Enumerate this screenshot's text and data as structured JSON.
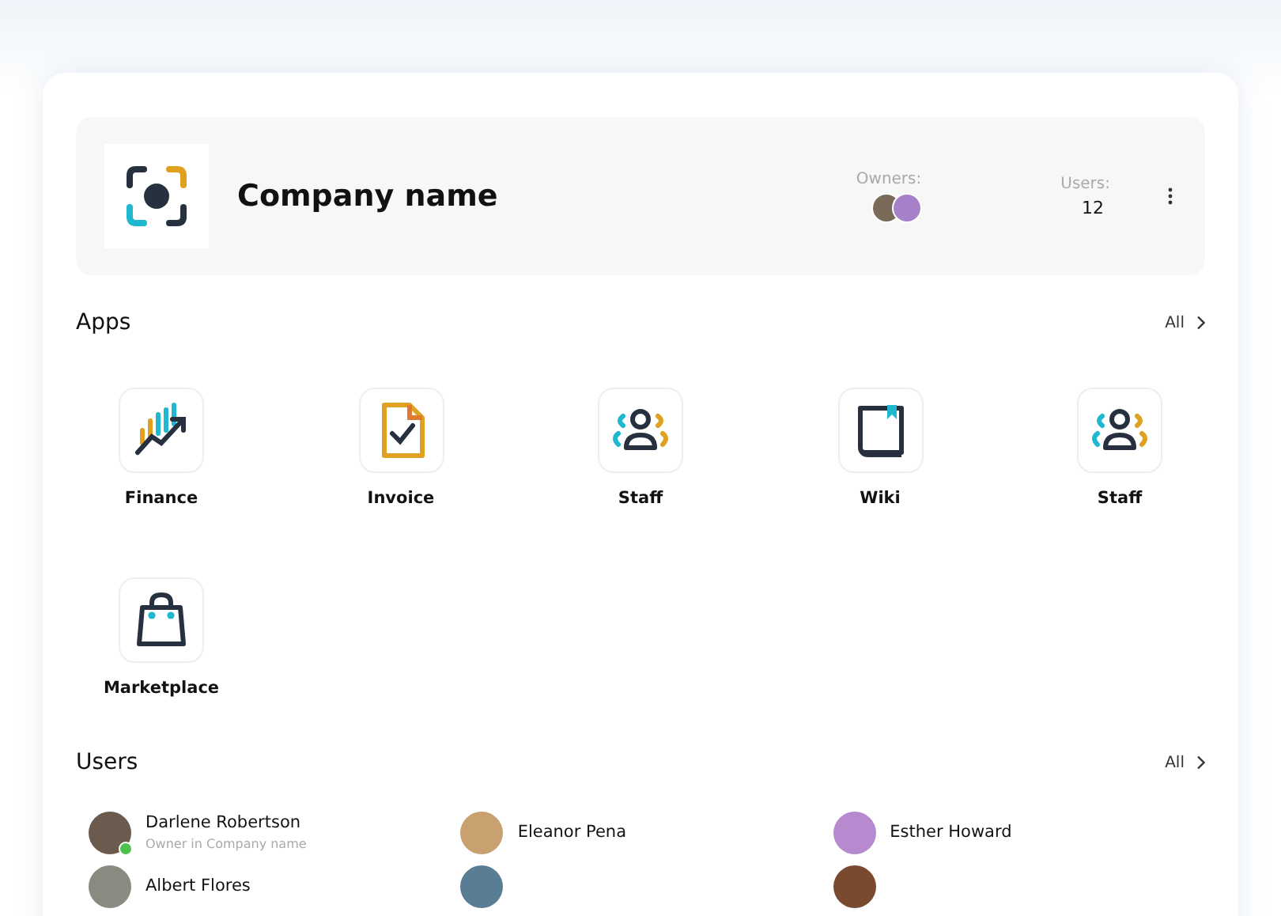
{
  "company": {
    "name": "Company name",
    "owners_label": "Owners:",
    "users_label": "Users:",
    "users_count": "12"
  },
  "apps_section": {
    "title": "Apps",
    "all_link": "All"
  },
  "apps": [
    {
      "kind": "finance",
      "label": "Finance"
    },
    {
      "kind": "invoice",
      "label": "Invoice"
    },
    {
      "kind": "staff",
      "label": "Staff"
    },
    {
      "kind": "wiki",
      "label": "Wiki"
    },
    {
      "kind": "staff",
      "label": "Staff"
    },
    {
      "kind": "marketplace",
      "label": "Marketplace"
    }
  ],
  "users_section": {
    "title": "Users",
    "all_link": "All"
  },
  "users": [
    {
      "name": "Darlene Robertson",
      "role": "Owner in Company name",
      "online": true
    },
    {
      "name": "Eleanor Pena",
      "online": false
    },
    {
      "name": "Esther Howard",
      "online": false
    },
    {
      "name": "Albert Flores",
      "online": false
    },
    {
      "online": false
    },
    {
      "online": false
    }
  ]
}
